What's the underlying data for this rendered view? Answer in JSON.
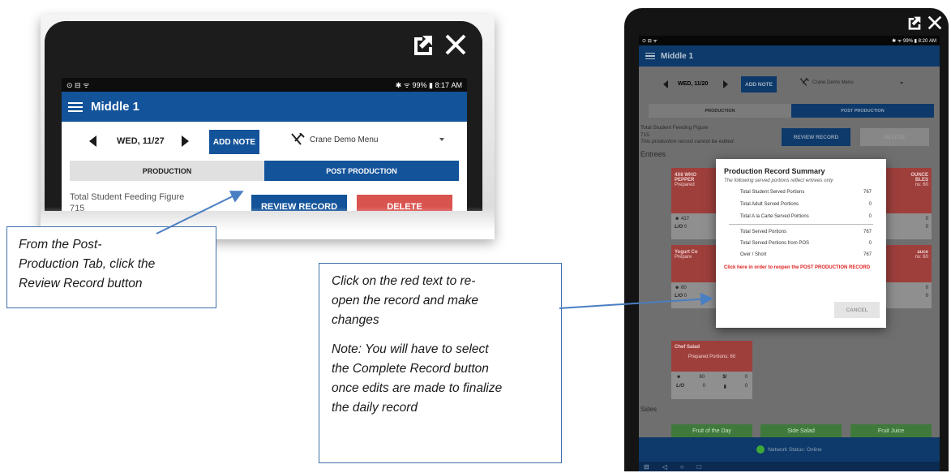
{
  "left_device": {
    "status": {
      "left": "⊙ ⊟ ᯤ",
      "right": "✱ ᯤ 99% ▮ 8:17 AM"
    },
    "school": "Middle 1",
    "date": "WED, 11/27",
    "add_note": "ADD NOTE",
    "menu": "Crane Demo Menu",
    "tabs": [
      "PRODUCTION",
      "POST PRODUCTION"
    ],
    "feeding_label": "Total Student Feeding Figure",
    "feeding_value": "715",
    "review_btn": "REVIEW RECORD",
    "delete_btn": "DELETE"
  },
  "callout_left": [
    "From the Post-",
    "Production Tab, click the",
    "Review Record button"
  ],
  "callout_mid": {
    "line1": [
      "Click on the red text to re-",
      "open the record and make",
      "changes"
    ],
    "line2": [
      "Note: You will have to select",
      "the Complete Record button",
      "once edits are made to finalize",
      "the daily record"
    ]
  },
  "right_device": {
    "status": {
      "left": "⊙ ⊟ ᯤ",
      "right": "✱ ᯤ 99% ▮ 8:20 AM"
    },
    "school": "Middle 1",
    "date": "WED, 11/20",
    "add_note": "ADD NOTE",
    "menu": "Crane Demo Menu",
    "tabs": [
      "PRODUCTION",
      "POST PRODUCTION"
    ],
    "feeding_label": "Total Student Feeding Figure",
    "feeding_value": "715",
    "cannot_edit": "This production record cannot be edited.",
    "review_btn": "REVIEW RECORD",
    "delete_btn": "DELETE",
    "entrees_label": "Entrees",
    "sides_label": "Sides",
    "card_frag": {
      "c1_title_a": "4X6 WHO",
      "c1_title_b": "PEPPER",
      "c1_prep": "Prepared",
      "c1_n1": "417",
      "c1_n2": "0",
      "c1_lo": "L/O",
      "c3_title_a": "OUNCE",
      "c3_title_b": "BLES",
      "c3_prep": "ns: 60",
      "c3_n1": "0",
      "c3_n2": "0",
      "c4_title": "Yogurt Co",
      "c4_prep": "Prepare",
      "c4_n1": "60",
      "c4_n2": "0",
      "c4_lo": "L/O",
      "c6_title": "auce",
      "c6_prep": "ns: 60",
      "c6_n1": "0",
      "c6_n2": "0",
      "c7_title": "Chef Salad",
      "c7_prep": "Prepared Portions: 60",
      "c7_n1": "60",
      "c7_sym": "$/",
      "c7_n2": "0",
      "c7_lo": "L/O",
      "c7_n3": "0",
      "c7_n4": "0"
    },
    "sides": [
      "Fruit of the Day",
      "Side Salad",
      "Fruit Juice"
    ],
    "network": "Network Status: Online",
    "modal": {
      "title": "Production Record Summary",
      "subtitle": "The following served portions reflect entrees only",
      "rows1": [
        {
          "label": "Total Student Served Portions",
          "value": "767"
        },
        {
          "label": "Total Adult Served Portions",
          "value": "0"
        },
        {
          "label": "Total A la Carte Served Portions",
          "value": "0"
        }
      ],
      "rows2": [
        {
          "label": "Total Served Portions",
          "value": "767"
        },
        {
          "label": "Total Served Portions from POS",
          "value": "0"
        },
        {
          "label": "Over / Short",
          "value": "767"
        }
      ],
      "reopen": "Click here in order to reopen the POST PRODUCTION RECORD",
      "cancel": "CANCEL"
    }
  },
  "colors": {
    "navy": "#13539a",
    "red": "#d9534f",
    "green": "#3f7a3c",
    "arrow": "#4a7ec2"
  },
  "icons": [
    "external-link-icon",
    "close-icon",
    "hamburger-icon",
    "fork-knife-icon",
    "dropdown-arrow-icon",
    "wifi-icon"
  ]
}
